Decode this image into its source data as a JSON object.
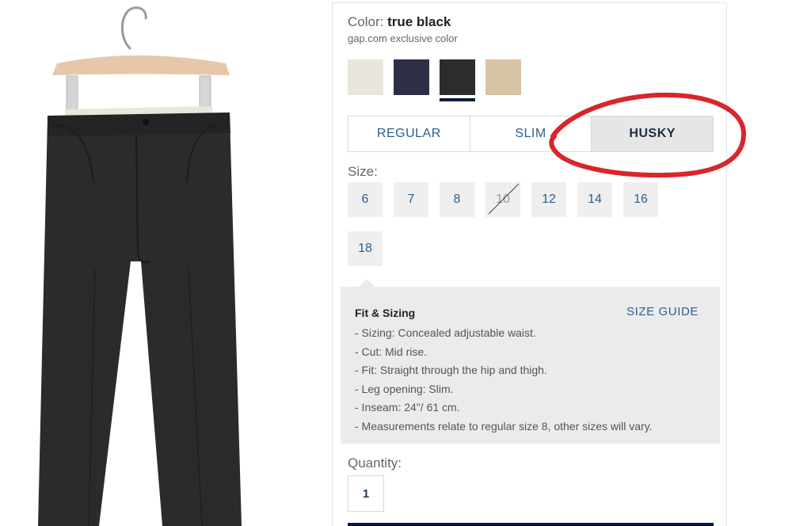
{
  "color": {
    "label": "Color: ",
    "name": "true black",
    "note": "gap.com exclusive color",
    "swatches": [
      {
        "name": "stone",
        "hex": "#e8e6dd"
      },
      {
        "name": "navy",
        "hex": "#2c2f45"
      },
      {
        "name": "true black",
        "hex": "#2b2c2b",
        "selected": true
      },
      {
        "name": "khaki",
        "hex": "#d6c4a5"
      }
    ]
  },
  "fit_tabs": [
    {
      "label": "REGULAR",
      "active": false
    },
    {
      "label": "SLIM",
      "active": false
    },
    {
      "label": "HUSKY",
      "active": true
    }
  ],
  "size": {
    "label": "Size:",
    "options": [
      {
        "label": "6",
        "available": true
      },
      {
        "label": "7",
        "available": true
      },
      {
        "label": "8",
        "available": true
      },
      {
        "label": "10",
        "available": false
      },
      {
        "label": "12",
        "available": true
      },
      {
        "label": "14",
        "available": true
      },
      {
        "label": "16",
        "available": true
      },
      {
        "label": "18",
        "available": true
      }
    ]
  },
  "fit_sizing": {
    "title": "Fit & Sizing",
    "size_guide": "SIZE GUIDE",
    "lines": [
      "- Sizing: Concealed adjustable waist.",
      "- Cut: Mid rise.",
      "- Fit: Straight through the hip and thigh.",
      "- Leg opening: Slim.",
      "- Inseam: 24\"/ 61 cm.",
      "- Measurements relate to regular size 8, other sizes will vary."
    ]
  },
  "quantity": {
    "label": "Quantity:",
    "value": "1"
  },
  "colors": {
    "accent_blue": "#2b5f8f",
    "dark_navy": "#0b1a3a",
    "annotation_red": "#d9252b"
  }
}
